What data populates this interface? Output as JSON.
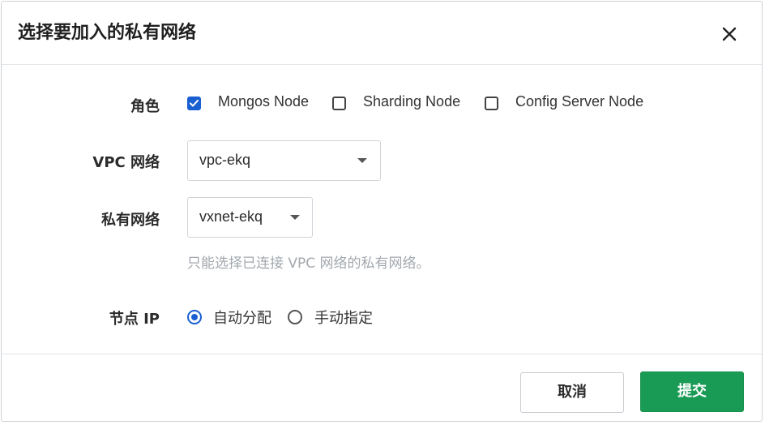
{
  "dialog": {
    "title": "选择要加入的私有网络"
  },
  "role": {
    "label": "角色",
    "options": [
      {
        "label": "Mongos Node",
        "checked": true
      },
      {
        "label": "Sharding Node",
        "checked": false
      },
      {
        "label": "Config Server Node",
        "checked": false
      }
    ]
  },
  "vpc": {
    "label": "VPC 网络",
    "value": "vpc-ekq"
  },
  "vxnet": {
    "label": "私有网络",
    "value": "vxnet-ekq",
    "hint": "只能选择已连接 VPC 网络的私有网络。"
  },
  "node_ip": {
    "label": "节点 IP",
    "options": [
      {
        "label": "自动分配",
        "selected": true
      },
      {
        "label": "手动指定",
        "selected": false
      }
    ]
  },
  "footer": {
    "cancel_label": "取消",
    "submit_label": "提交"
  },
  "colors": {
    "accent": "#1a5fd1",
    "submit": "#1a9b55"
  }
}
